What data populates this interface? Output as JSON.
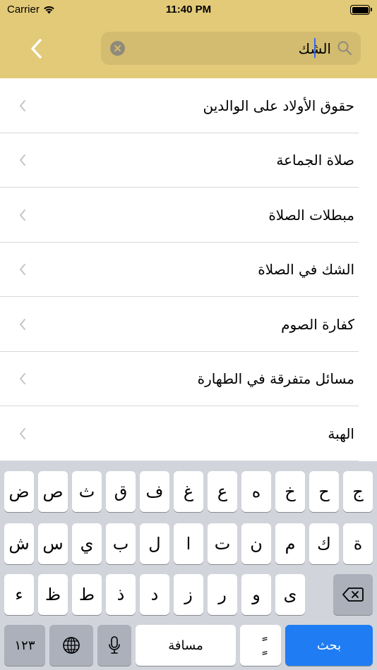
{
  "status_bar": {
    "carrier": "Carrier",
    "time": "11:40 PM"
  },
  "search": {
    "value": "الشك",
    "placeholder": ""
  },
  "list_items": [
    "حقوق الأولاد على الوالدين",
    "صلاة الجماعة",
    "مبطلات الصلاة",
    "الشك في الصلاة",
    "كفارة الصوم",
    "مسائل متفرقة في الطهارة",
    "الهبة"
  ],
  "keyboard": {
    "row1": [
      "ض",
      "ص",
      "ث",
      "ق",
      "ف",
      "غ",
      "ع",
      "ه",
      "خ",
      "ح",
      "ج"
    ],
    "row2": [
      "ش",
      "س",
      "ي",
      "ب",
      "ل",
      "ا",
      "ت",
      "ن",
      "م",
      "ك",
      "ة"
    ],
    "row3": [
      "ء",
      "ظ",
      "ط",
      "ذ",
      "د",
      "ز",
      "ر",
      "و",
      "ى"
    ],
    "numbers_key": "١٢٣",
    "space_key": "مسافة",
    "tanween_key": "ًٍ",
    "search_key": "بحث"
  },
  "colors": {
    "header": "#e3ca78",
    "search_bg": "#d3bc70",
    "accent": "#1f7cf2"
  }
}
